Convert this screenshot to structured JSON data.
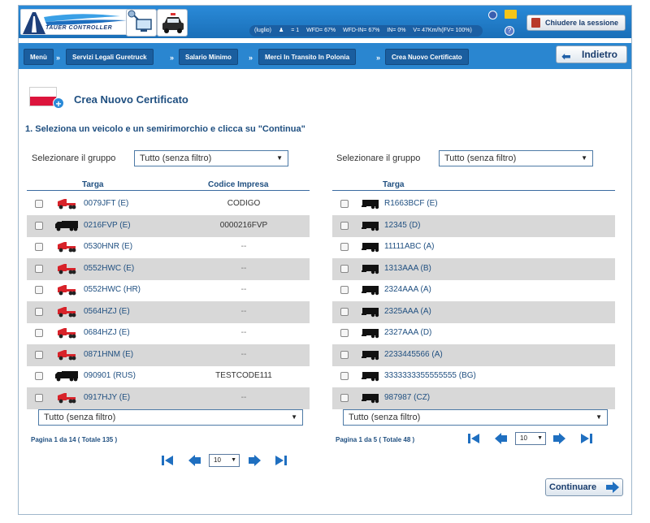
{
  "header": {
    "logo_text": "TAUER CONTROLLER",
    "status": {
      "month": "(luglio)",
      "users": "= 1",
      "wfd": "WFD= 67%",
      "wfd_in": "WFD-IN= 67%",
      "in": "IN= 0%",
      "speed": "V= 47Km/h(FV= 100%)"
    },
    "logout_label": "Chiudere la sessione"
  },
  "breadcrumb": {
    "items": [
      "Menù",
      "Servizi Legali Guretruck",
      "Salario Minimo",
      "Merci In Transito In Polonia",
      "Crea Nuovo Certificato"
    ],
    "separator": "»",
    "back_label": "Indietro"
  },
  "page": {
    "title": "Crea Nuovo Certificato",
    "step": "1. Seleziona un veicolo e un semirimorchio e clicca su \"Continua\""
  },
  "vehicles": {
    "group_label": "Selezionare il gruppo",
    "group_value": "Tutto (senza filtro)",
    "col_plate": "Targa",
    "col_code": "Codice Impresa",
    "rows": [
      {
        "plate": "0079JFT (E)",
        "code": "CODIGO",
        "type": "tractor"
      },
      {
        "plate": "0216FVP (E)",
        "code": "0000216FVP",
        "type": "truck"
      },
      {
        "plate": "0530HNR (E)",
        "code": "--",
        "type": "tractor"
      },
      {
        "plate": "0552HWC (E)",
        "code": "--",
        "type": "tractor"
      },
      {
        "plate": "0552HWC (HR)",
        "code": "--",
        "type": "tractor"
      },
      {
        "plate": "0564HZJ (E)",
        "code": "--",
        "type": "tractor"
      },
      {
        "plate": "0684HZJ (E)",
        "code": "--",
        "type": "tractor"
      },
      {
        "plate": "0871HNM (E)",
        "code": "--",
        "type": "tractor"
      },
      {
        "plate": "090901 (RUS)",
        "code": "TESTCODE111",
        "type": "truck"
      },
      {
        "plate": "0917HJY (E)",
        "code": "--",
        "type": "tractor"
      }
    ],
    "bottom_filter": "Tutto (senza filtro)",
    "page_info": "Pagina 1   da   14   ( Totale 135 )",
    "page_size": "10"
  },
  "trailers": {
    "group_label": "Selezionare il gruppo",
    "group_value": "Tutto (senza filtro)",
    "col_plate": "Targa",
    "rows": [
      {
        "plate": "R1663BCF (E)"
      },
      {
        "plate": "12345 (D)"
      },
      {
        "plate": "11111ABC (A)"
      },
      {
        "plate": "1313AAA (B)"
      },
      {
        "plate": "2324AAA (A)"
      },
      {
        "plate": "2325AAA (A)"
      },
      {
        "plate": "2327AAA (D)"
      },
      {
        "plate": "2233445566 (A)"
      },
      {
        "plate": "3333333355555555 (BG)"
      },
      {
        "plate": "987987 (CZ)"
      }
    ],
    "bottom_filter": "Tutto (senza filtro)",
    "page_info": "Pagina 1   da   5   ( Totale 48 )",
    "page_size": "10"
  },
  "continue_label": "Continuare",
  "colors": {
    "primary": "#2a86d0",
    "dark": "#1a5e9f",
    "text_blue": "#1f4f80",
    "row_alt": "#d8d8d8",
    "tractor_red": "#d8232a"
  }
}
